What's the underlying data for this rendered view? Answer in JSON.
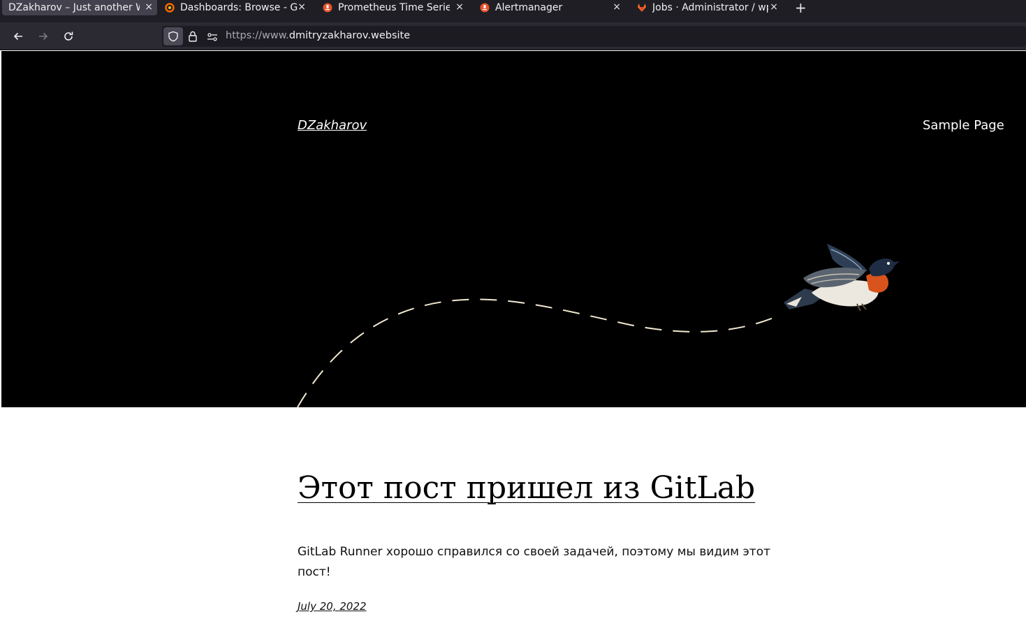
{
  "browser": {
    "tabs": [
      {
        "title": "DZakharov – Just another W",
        "favicon": "none",
        "active": true
      },
      {
        "title": "Dashboards: Browse - Gra",
        "favicon": "grafana-icon",
        "active": false
      },
      {
        "title": "Prometheus Time Series C",
        "favicon": "prometheus-icon",
        "active": false
      },
      {
        "title": "Alertmanager",
        "favicon": "prometheus-icon",
        "active": false
      },
      {
        "title": "Jobs · Administrator / wp",
        "favicon": "gitlab-icon",
        "active": false
      }
    ],
    "tab_close": "×",
    "new_tab": "+",
    "url_scheme": "https://www.",
    "url_host": "dmitryzakharov.website"
  },
  "site": {
    "title": "DZakharov",
    "nav": {
      "sample_page": "Sample Page"
    }
  },
  "post": {
    "title": "Этот пост пришел из GitLab",
    "excerpt": "GitLab Runner хорошо справился со своей задачей, поэтому мы видим этот пост!",
    "date": "July 20, 2022"
  },
  "colors": {
    "chrome_dark": "#1f1e25",
    "toolbar": "#2b2a33",
    "hero_bg": "#000000",
    "grafana": "#f46800",
    "prometheus": "#e6522c",
    "gitlab": "#fc6d26"
  }
}
